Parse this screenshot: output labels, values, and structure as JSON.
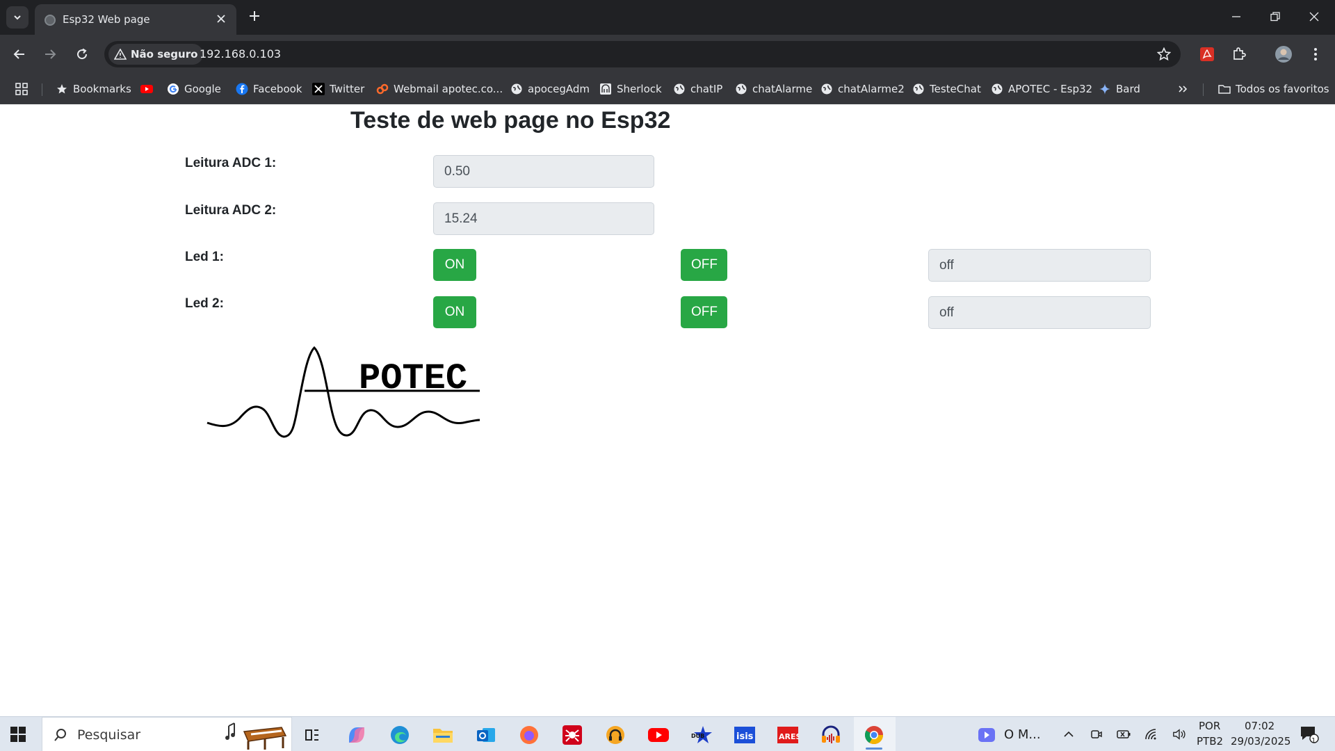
{
  "tab": {
    "title": "Esp32 Web page"
  },
  "address": {
    "security_label": "Não seguro",
    "url": "192.168.0.103"
  },
  "bookmarks": {
    "items": [
      {
        "label": "Bookmarks",
        "icon": "star-icon"
      },
      {
        "label": "",
        "icon": "youtube-icon"
      },
      {
        "label": "Google",
        "icon": "google-icon"
      },
      {
        "label": "Facebook",
        "icon": "facebook-icon"
      },
      {
        "label": "Twitter",
        "icon": "x-icon"
      },
      {
        "label": "Webmail apotec.co...",
        "icon": "webmail-icon"
      },
      {
        "label": "apocegAdm",
        "icon": "globe-icon"
      },
      {
        "label": "Sherlock",
        "icon": "sherlock-icon"
      },
      {
        "label": "chatIP",
        "icon": "globe-icon"
      },
      {
        "label": "chatAlarme",
        "icon": "globe-icon"
      },
      {
        "label": "chatAlarme2",
        "icon": "globe-icon"
      },
      {
        "label": "TesteChat",
        "icon": "globe-icon"
      },
      {
        "label": "APOTEC - Esp32",
        "icon": "globe-icon"
      },
      {
        "label": "Bard",
        "icon": "bard-icon"
      }
    ],
    "all_bookmarks_label": "Todos os favoritos"
  },
  "page": {
    "title": "Teste de web page no Esp32",
    "adc1_label": "Leitura ADC 1:",
    "adc1_value": "0.50",
    "adc2_label": "Leitura ADC 2:",
    "adc2_value": "15.24",
    "led1_label": "Led 1:",
    "led1_on_label": "ON",
    "led1_off_label": "OFF",
    "led1_state": "off",
    "led2_label": "Led 2:",
    "led2_on_label": "ON",
    "led2_off_label": "OFF",
    "led2_state": "off",
    "logo_text": "POTEC",
    "accent_color": "#28a745"
  },
  "taskbar": {
    "search_placeholder": "Pesquisar",
    "running_app_label": "O M...",
    "lang_top": "POR",
    "lang_bottom": "PTB2",
    "time": "07:02",
    "date": "29/03/2025",
    "notification_count": "1"
  }
}
